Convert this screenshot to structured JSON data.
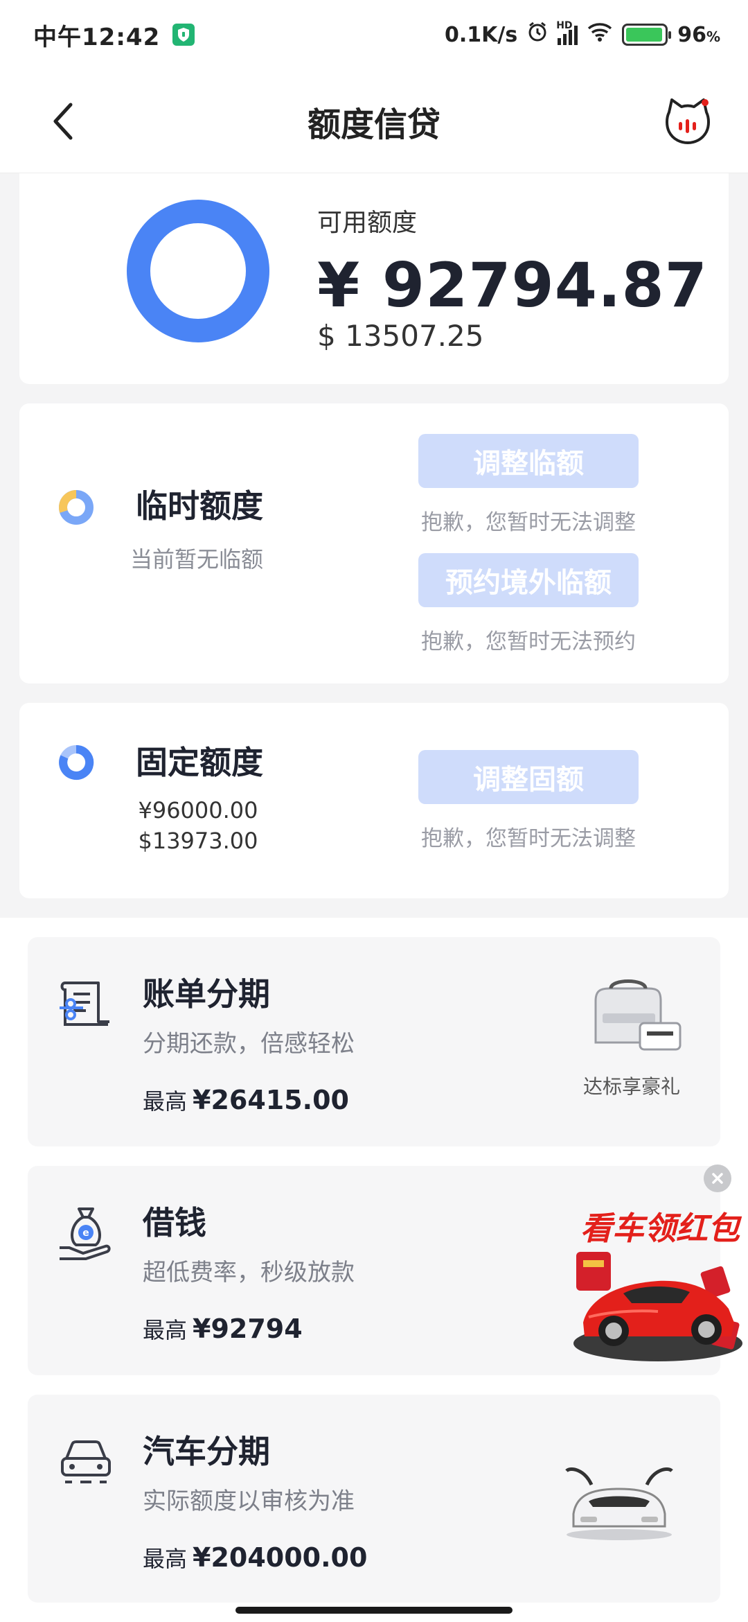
{
  "status_bar": {
    "time": "中午12:42",
    "network_speed": "0.1K/s",
    "network_type": "HD",
    "battery_level": "96",
    "battery_unit": "%",
    "battery_fill_fraction": 0.96,
    "icons": [
      "shield-app-icon",
      "alarm-icon",
      "signal-icon",
      "wifi-icon",
      "battery-charging-icon"
    ]
  },
  "header": {
    "title": "额度信贷",
    "back_icon": "chevron-left-icon",
    "assistant_icon": "cat-mascot-icon"
  },
  "available": {
    "label": "可用额度",
    "cny": "¥ 92794.87",
    "usd": "$ 13507.25",
    "ring_color": "#4a84f5"
  },
  "temporary": {
    "title": "临时额度",
    "subtitle": "当前暂无临额",
    "adjust_button": "调整临额",
    "adjust_note": "抱歉，您暂时无法调整",
    "reserve_button": "预约境外临额",
    "reserve_note": "抱歉，您暂时无法预约",
    "icon": "donut-yellow-blue-icon"
  },
  "fixed": {
    "title": "固定额度",
    "cny": "¥96000.00",
    "usd": "$13973.00",
    "adjust_button": "调整固额",
    "adjust_note": "抱歉，您暂时无法调整",
    "icon": "donut-blue-icon"
  },
  "services": [
    {
      "title": "账单分期",
      "subtitle": "分期还款，倍感轻松",
      "max_label": "最高",
      "max_value": "¥26415.00",
      "icon": "bill-installment-icon",
      "promo_caption": "达标享豪礼",
      "promo_icon": "luggage-gift-icon"
    },
    {
      "title": "借钱",
      "subtitle": "超低费率，秒级放款",
      "max_label": "最高",
      "max_value": "¥92794",
      "icon": "money-bag-hand-icon"
    },
    {
      "title": "汽车分期",
      "subtitle": "实际额度以审核为准",
      "max_label": "最高",
      "max_value": "¥204000.00",
      "icon": "car-icon",
      "promo_icon": "white-car-icon"
    }
  ],
  "ad": {
    "text": "看车领红包",
    "close_icon": "close-icon",
    "image_icon": "red-sports-car-icon"
  },
  "colors": {
    "accent": "#4a84f5",
    "disabled_button": "#cfdcfb",
    "ad_red": "#e3201b"
  }
}
